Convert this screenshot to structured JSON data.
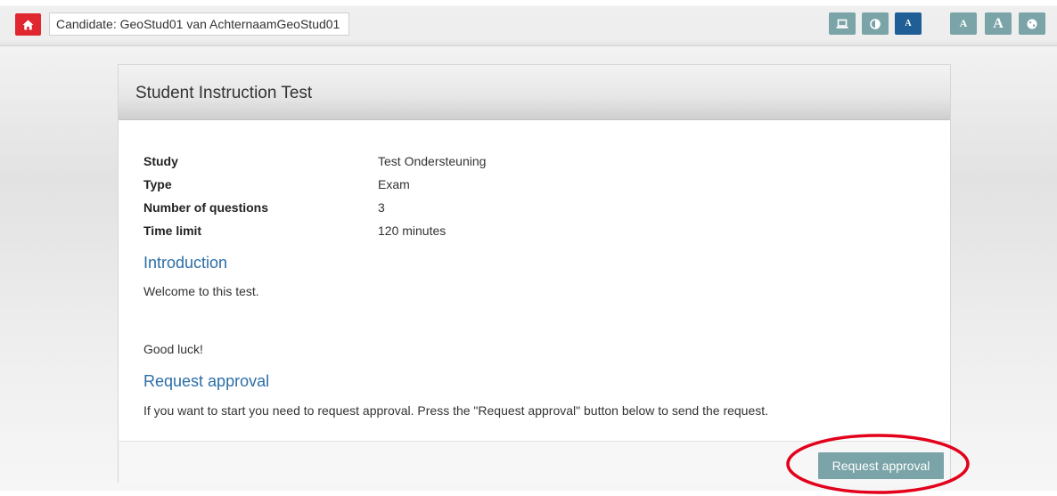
{
  "header": {
    "home_icon": "home-icon",
    "candidate_label": "Candidate: GeoStud01 van AchternaamGeoStud01",
    "tools": [
      {
        "name": "screen-icon",
        "glyph": ""
      },
      {
        "name": "contrast-icon",
        "glyph": ""
      },
      {
        "name": "font-small-icon",
        "glyph": "A"
      },
      {
        "name": "font-medium-icon",
        "glyph": "A"
      },
      {
        "name": "font-large-icon",
        "glyph": "A"
      },
      {
        "name": "globe-icon",
        "glyph": ""
      }
    ]
  },
  "test": {
    "title": "Student Instruction Test",
    "details": [
      {
        "label": "Study",
        "value": "Test Ondersteuning"
      },
      {
        "label": "Type",
        "value": "Exam"
      },
      {
        "label": "Number of questions",
        "value": "3"
      },
      {
        "label": "Time limit",
        "value": "120 minutes"
      }
    ],
    "introduction": {
      "heading": "Introduction",
      "line1": "Welcome to this test.",
      "line2": "Good luck!"
    },
    "request": {
      "heading": "Request approval",
      "text": "If you want to start you need to request approval. Press the \"Request approval\" button below to send the request.",
      "button_label": "Request approval"
    }
  },
  "colors": {
    "home": "#e0272f",
    "tool": "#7aa4a8",
    "tool_active": "#1f5f95",
    "heading": "#2b6ea6",
    "annotation": "#e3001b"
  }
}
